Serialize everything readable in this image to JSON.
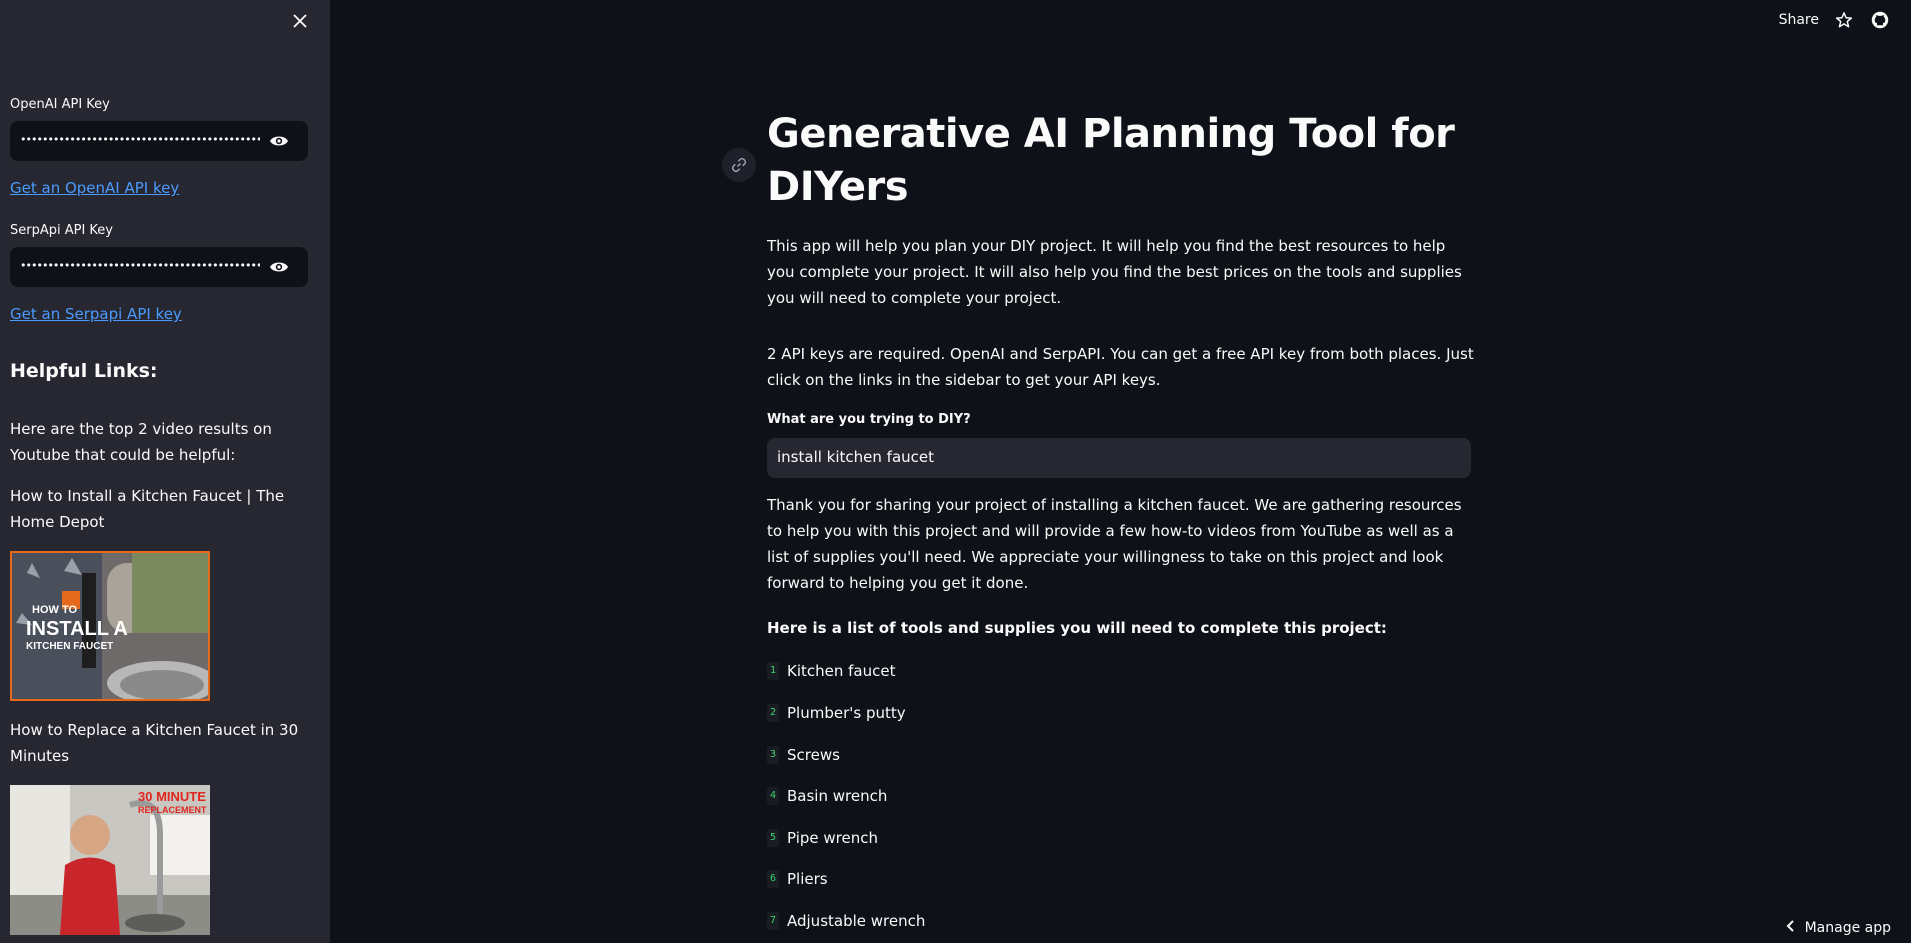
{
  "sidebar": {
    "openai_label": "OpenAI API Key",
    "openai_value": "••••••••••••••••••••••••••••••••••••••••••••••••••••",
    "openai_link": "Get an OpenAI API key",
    "serp_label": "SerpApi API Key",
    "serp_value": "••••••••••••••••••••••••••••••••••••••••••••••••••••",
    "serp_link": "Get an Serpapi API key",
    "helpful_heading": "Helpful Links:",
    "videos_intro": "Here are the top 2 video results on Youtube that could be helpful:",
    "video1_title": "How to Install a Kitchen Faucet | The Home Depot",
    "video1_thumb_text": "INSTALL A",
    "video1_thumb_subtext": "KITCHEN FAUCET",
    "video1_thumb_prefix": "HOW TO",
    "video2_title": "How to Replace a Kitchen Faucet in 30 Minutes",
    "video2_thumb_text": "30 MINUTE",
    "video2_thumb_subtext": "REPLACEMENT"
  },
  "topbar": {
    "share_label": "Share",
    "icons": [
      "star-icon",
      "github-icon"
    ]
  },
  "main": {
    "title": "Generative AI Planning Tool for DIYers",
    "intro": "This app will help you plan your DIY project. It will help you find the best resources to help you complete your project. It will also help you find the best prices on the tools and supplies you will need to complete your project.",
    "api_note": "2 API keys are required. OpenAI and SerpAPI. You can get a free API key from both places. Just click on the links in the sidebar to get your API keys.",
    "input_label": "What are you trying to DIY?",
    "input_value": "install kitchen faucet",
    "response": "Thank you for sharing your project of installing a kitchen faucet. We are gathering resources to help you with this project and will provide a few how-to videos from YouTube as well as a list of supplies you'll need. We appreciate your willingness to take on this project and look forward to helping you get it done.",
    "list_heading": "Here is a list of tools and supplies you will need to complete this project:",
    "items": [
      {
        "num": "1",
        "label": "Kitchen faucet"
      },
      {
        "num": "2",
        "label": "Plumber's putty"
      },
      {
        "num": "3",
        "label": "Screws"
      },
      {
        "num": "4",
        "label": "Basin wrench"
      },
      {
        "num": "5",
        "label": "Pipe wrench"
      },
      {
        "num": "6",
        "label": "Pliers"
      },
      {
        "num": "7",
        "label": "Adjustable wrench"
      }
    ]
  },
  "footer": {
    "manage_label": "Manage app"
  },
  "colors": {
    "background": "#0e1117",
    "sidebar": "#262730",
    "link": "#4b9bff",
    "list_number": "#3dd56d",
    "thumb_border": "#e56a1c"
  }
}
